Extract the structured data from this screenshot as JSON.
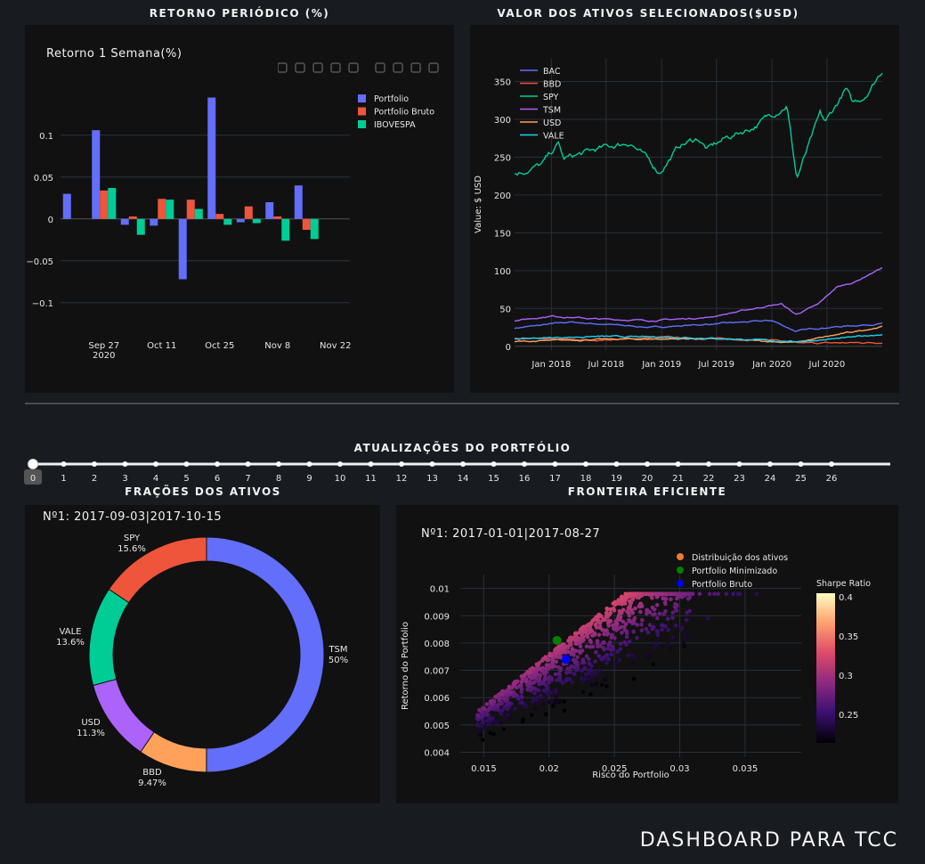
{
  "headers": {
    "returns": "RETORNO PERIÓDICO (%)",
    "assets": "VALOR DOS ATIVOS SELECIONADOS($USD)",
    "slider": "ATUALIZAÇÕES DO PORTFÓLIO",
    "fractions": "FRAÇÕES DOS ATIVOS",
    "frontier": "FRONTEIRA EFICIENTE"
  },
  "footer": "DASHBOARD PARA TCC",
  "slider": {
    "selected": 0,
    "steps": [
      "0",
      "1",
      "2",
      "3",
      "4",
      "5",
      "6",
      "7",
      "8",
      "9",
      "10",
      "11",
      "12",
      "13",
      "14",
      "15",
      "16",
      "17",
      "18",
      "19",
      "20",
      "21",
      "22",
      "23",
      "24",
      "25",
      "26"
    ]
  },
  "modebar_icons": [
    "camera-icon",
    "zoom-icon",
    "pan-icon",
    "box-select-icon",
    "lasso-icon",
    "zoom-in-icon",
    "zoom-out-icon",
    "autoscale-icon",
    "reset-axes-icon",
    "plotly-logo-icon"
  ],
  "chart_data": [
    {
      "id": "returns",
      "type": "bar",
      "title": "Retorno 1 Semana(%)",
      "colors": [
        "#636efa",
        "#ef553b",
        "#00cc96"
      ],
      "x": [
        "2020-09-20",
        "2020-09-27",
        "2020-10-04",
        "2020-10-11",
        "2020-10-18",
        "2020-10-25",
        "2020-11-01",
        "2020-11-08",
        "2020-11-15",
        "2020-11-22"
      ],
      "xticks": [
        {
          "date": "2020-09-27",
          "label": "Sep 27",
          "sub": "2020"
        },
        {
          "date": "2020-10-11",
          "label": "Oct 11",
          "sub": ""
        },
        {
          "date": "2020-10-25",
          "label": "Oct 25",
          "sub": ""
        },
        {
          "date": "2020-11-08",
          "label": "Nov 8",
          "sub": ""
        },
        {
          "date": "2020-11-22",
          "label": "Nov 22",
          "sub": ""
        }
      ],
      "series": [
        {
          "name": "Portfolio",
          "values": [
            0.03,
            0.106,
            -0.007,
            -0.008,
            -0.072,
            0.145,
            -0.004,
            0.02,
            0.04,
            null
          ]
        },
        {
          "name": "Portfolio Bruto",
          "values": [
            null,
            0.034,
            0.003,
            0.024,
            0.023,
            0.006,
            0.015,
            0.003,
            -0.013,
            null
          ]
        },
        {
          "name": "IBOVESPA",
          "values": [
            null,
            0.037,
            -0.019,
            0.023,
            0.012,
            -0.007,
            -0.005,
            -0.026,
            -0.024,
            null
          ]
        }
      ],
      "yticks": [
        0.1,
        0.05,
        0,
        -0.05,
        -0.1
      ],
      "ytick_labels": [
        "0.1",
        "0.05",
        "0",
        "−0.05",
        "−0.1"
      ],
      "ylim": [
        -0.13,
        0.17
      ]
    },
    {
      "id": "assets",
      "type": "line",
      "ylabel": "Value: $ USD",
      "xlim": [
        "2017-09-01",
        "2020-12-31"
      ],
      "ylim": [
        -5,
        380
      ],
      "xticks": [
        "Jan 2018",
        "Jul 2018",
        "Jan 2019",
        "Jul 2019",
        "Jan 2020",
        "Jul 2020"
      ],
      "yticks": [
        0,
        50,
        100,
        150,
        200,
        250,
        300,
        350
      ],
      "series": [
        {
          "name": "BAC",
          "color": "#636efa",
          "x": [
            "2017-09-01",
            "2018-03-01",
            "2018-12-01",
            "2019-06-01",
            "2020-01-01",
            "2020-03-20",
            "2020-06-01",
            "2020-12-31"
          ],
          "y": [
            24,
            32,
            25,
            29,
            34,
            20,
            24,
            30
          ]
        },
        {
          "name": "BBD",
          "color": "#ef553b",
          "x": [
            "2017-09-01",
            "2018-06-01",
            "2019-01-01",
            "2019-10-01",
            "2020-01-01",
            "2020-03-20",
            "2020-12-31"
          ],
          "y": [
            10,
            8,
            12,
            9,
            9,
            4,
            5
          ]
        },
        {
          "name": "SPY",
          "color": "#00cc96",
          "x": [
            "2017-09-01",
            "2017-12-01",
            "2018-01-26",
            "2018-02-09",
            "2018-06-01",
            "2018-09-20",
            "2018-12-24",
            "2019-03-01",
            "2019-05-01",
            "2019-06-01",
            "2019-08-01",
            "2019-11-01",
            "2020-02-19",
            "2020-03-23",
            "2020-06-08",
            "2020-06-26",
            "2020-09-02",
            "2020-09-23",
            "2020-11-01",
            "2020-12-31"
          ],
          "y": [
            228,
            240,
            268,
            247,
            260,
            270,
            230,
            265,
            275,
            260,
            275,
            290,
            320,
            222,
            305,
            295,
            340,
            320,
            330,
            365
          ]
        },
        {
          "name": "TSM",
          "color": "#ab63fa",
          "x": [
            "2017-09-01",
            "2018-01-01",
            "2018-06-01",
            "2018-12-01",
            "2019-06-01",
            "2019-12-01",
            "2020-02-01",
            "2020-03-20",
            "2020-06-01",
            "2020-08-01",
            "2020-10-01",
            "2020-12-31"
          ],
          "y": [
            34,
            40,
            36,
            34,
            38,
            52,
            56,
            42,
            55,
            78,
            85,
            104
          ]
        },
        {
          "name": "USD",
          "color": "#ffa15a",
          "x": [
            "2017-09-01",
            "2018-06-01",
            "2019-06-01",
            "2020-03-20",
            "2020-08-01",
            "2020-12-31"
          ],
          "y": [
            6,
            9,
            10,
            5,
            15,
            26
          ]
        },
        {
          "name": "VALE",
          "color": "#19d3f3",
          "x": [
            "2017-09-01",
            "2018-06-01",
            "2019-01-01",
            "2019-06-01",
            "2020-03-20",
            "2020-09-01",
            "2020-12-31"
          ],
          "y": [
            10,
            13,
            12,
            11,
            6,
            11,
            16
          ]
        }
      ]
    },
    {
      "id": "fractions",
      "type": "pie",
      "title": "Nº1: 2017-09-03|2017-10-15",
      "labels": [
        "TSM",
        "BBD",
        "USD",
        "VALE",
        "SPY"
      ],
      "values": [
        50,
        9.47,
        11.3,
        13.6,
        15.6
      ],
      "value_labels": [
        "50%",
        "9.47%",
        "11.3%",
        "13.6%",
        "15.6%"
      ],
      "colors": [
        "#636efa",
        "#ffa15a",
        "#ab63fa",
        "#00cc96",
        "#ef553b"
      ]
    },
    {
      "id": "frontier",
      "type": "scatter",
      "title": "Nº1: 2017-01-01|2017-08-27",
      "xlabel": "Risco do Portfolio",
      "ylabel": "Retorno do Portfolio",
      "xlim": [
        0.0132,
        0.0393
      ],
      "ylim": [
        0.00382,
        0.01051
      ],
      "xticks": [
        0.015,
        0.02,
        0.025,
        0.03,
        0.035
      ],
      "xtick_labels": [
        "0.015",
        "0.02",
        "0.025",
        "0.03",
        "0.035"
      ],
      "yticks": [
        0.004,
        0.005,
        0.006,
        0.007,
        0.008,
        0.009,
        0.01
      ],
      "ytick_labels": [
        "0.004",
        "0.005",
        "0.006",
        "0.007",
        "0.008",
        "0.009",
        "0.01"
      ],
      "colorbar": {
        "title": "Sharpe Ratio",
        "ticks": [
          "0.4",
          "0.35",
          "0.3",
          "0.25"
        ]
      },
      "legend": [
        {
          "name": "Distribuição dos ativos",
          "color": "#ef7a30"
        },
        {
          "name": "Portfolio Minimizado",
          "color": "#008000"
        },
        {
          "name": "Portfolio Bruto",
          "color": "#0000ff"
        }
      ],
      "special_points": [
        {
          "name": "Portfolio Minimizado",
          "x": 0.0206,
          "y": 0.0081,
          "color": "#008000"
        },
        {
          "name": "Portfolio Bruto",
          "x": 0.0213,
          "y": 0.0074,
          "color": "#0000ff"
        }
      ],
      "n_points": 900
    }
  ]
}
